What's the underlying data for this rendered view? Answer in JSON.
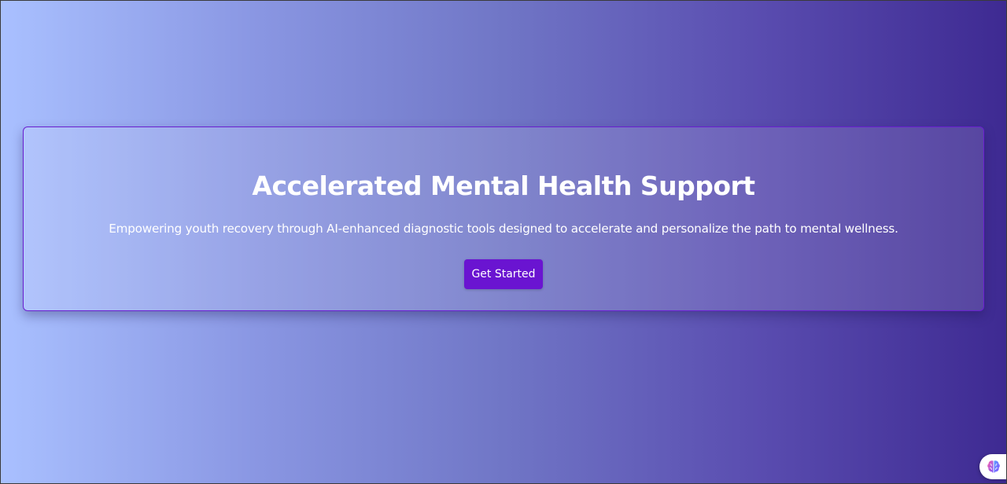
{
  "hero": {
    "title": "Accelerated Mental Health Support",
    "subtitle": "Empowering youth recovery through AI-enhanced diagnostic tools designed to accelerate and personalize the path to mental wellness.",
    "cta_label": "Get Started"
  },
  "floating_widget": {
    "icon": "brain-icon"
  },
  "colors": {
    "gradient_start": "#a9c0ff",
    "gradient_end": "#3e2a92",
    "card_border": "#6a1fd0",
    "button_bg": "#6a14d1",
    "text": "#ffffff"
  }
}
